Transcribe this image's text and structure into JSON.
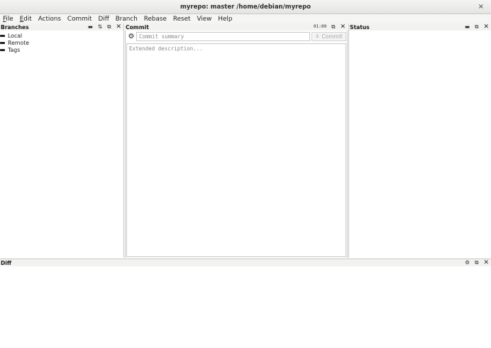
{
  "window": {
    "title": "myrepo: master /home/debian/myrepo",
    "close_glyph": "×"
  },
  "menubar": [
    {
      "pre": "",
      "acc": "F",
      "post": "ile"
    },
    {
      "pre": "",
      "acc": "E",
      "post": "dit"
    },
    {
      "pre": "",
      "acc": "",
      "post": "Actions"
    },
    {
      "pre": "",
      "acc": "",
      "post": "Commit"
    },
    {
      "pre": "",
      "acc": "",
      "post": "Diff"
    },
    {
      "pre": "",
      "acc": "",
      "post": "Branch"
    },
    {
      "pre": "",
      "acc": "",
      "post": "Rebase"
    },
    {
      "pre": "",
      "acc": "",
      "post": "Reset"
    },
    {
      "pre": "",
      "acc": "",
      "post": "View"
    },
    {
      "pre": "",
      "acc": "",
      "post": "Help"
    }
  ],
  "branches": {
    "title": "Branches",
    "buttons": {
      "collapse": "▬",
      "sort": "⇅",
      "float": "⧉",
      "close": "✕"
    },
    "items": [
      "Local",
      "Remote",
      "Tags"
    ]
  },
  "commit": {
    "title": "Commit",
    "timer": "01:00",
    "buttons": {
      "float": "⧉",
      "close": "✕"
    },
    "options_glyph": "⚙",
    "summary_placeholder": "Commit summary",
    "commit_label": "Commit",
    "commit_glyph": "⚓",
    "description_placeholder": "Extended description..."
  },
  "status": {
    "title": "Status",
    "buttons": {
      "collapse": "▬",
      "float": "⧉",
      "close": "✕"
    }
  },
  "diff": {
    "title": "Diff",
    "buttons": {
      "options": "⚙",
      "float": "⧉",
      "close": "✕"
    }
  }
}
